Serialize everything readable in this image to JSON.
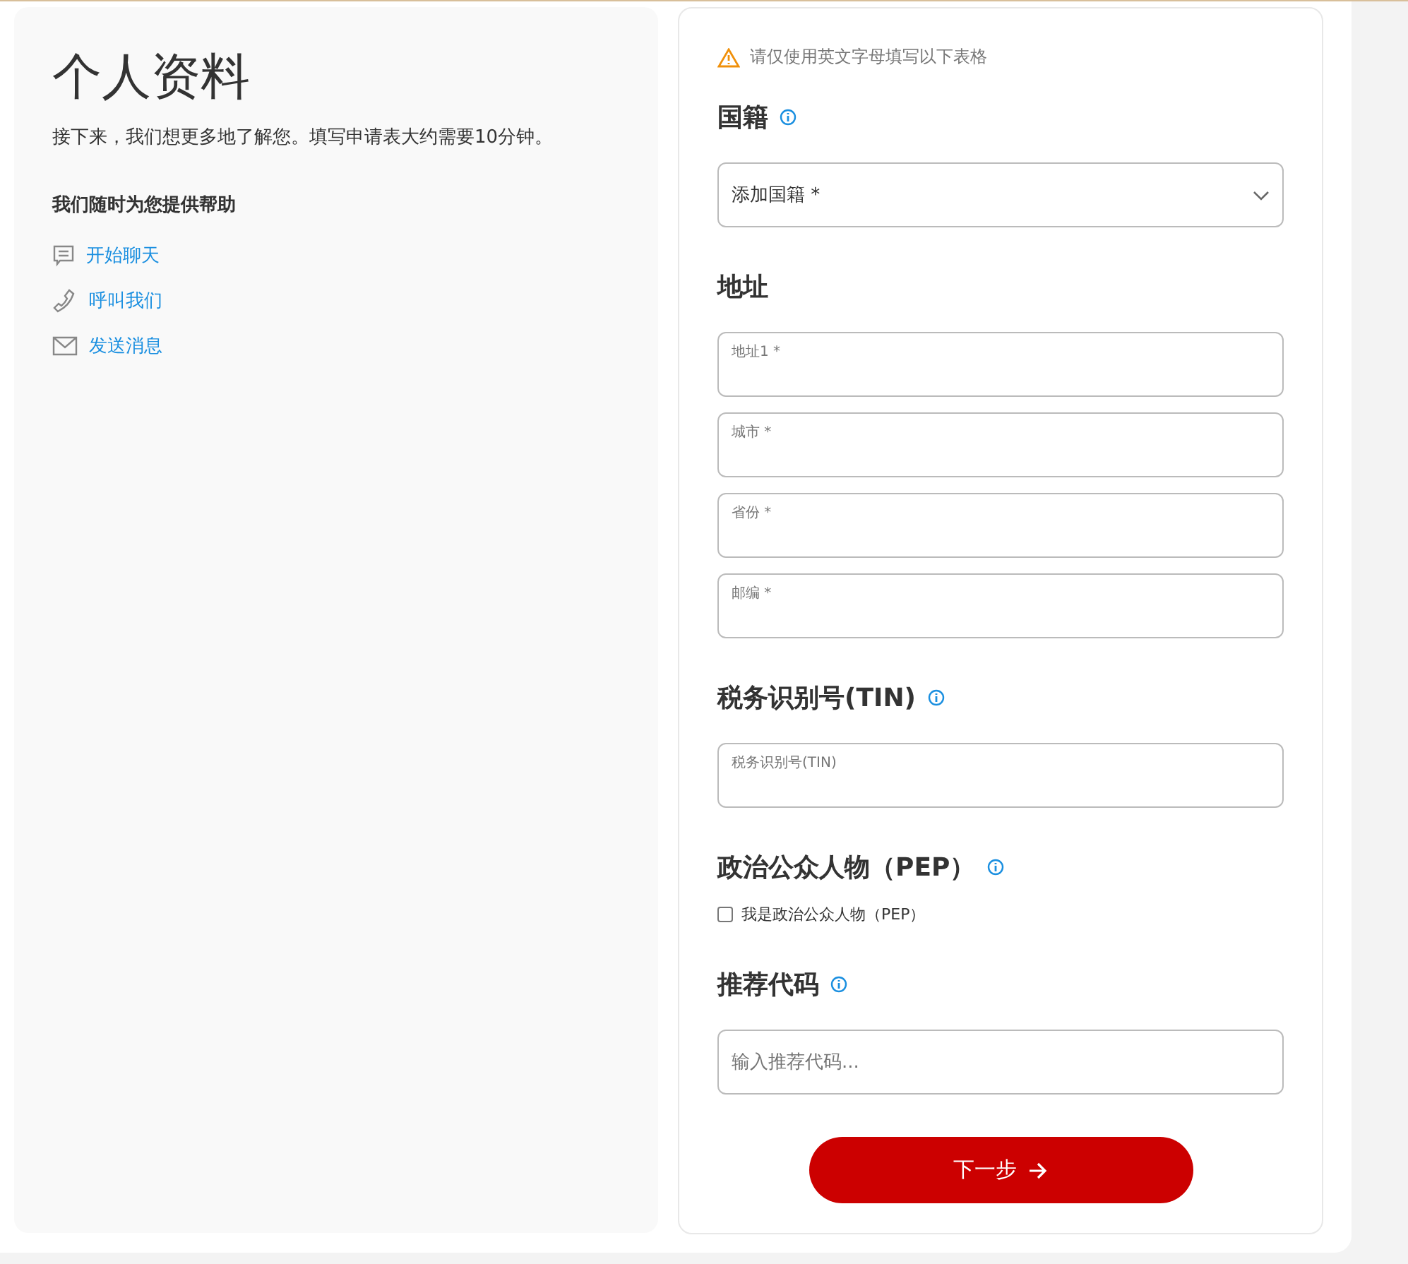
{
  "profile": {
    "title": "个人资料",
    "intro": "接下来，我们想更多地了解您。填写申请表大约需要10分钟。",
    "help_heading": "我们随时为您提供帮助",
    "help_links": [
      {
        "kind": "chat",
        "label": "开始聊天"
      },
      {
        "kind": "phone",
        "label": "呼叫我们"
      },
      {
        "kind": "mail",
        "label": "发送消息"
      }
    ]
  },
  "form": {
    "notice": "请仅使用英文字母填写以下表格",
    "sections": [
      {
        "heading": "国籍",
        "info": true,
        "fields": [
          {
            "kind": "select",
            "placeholder": "添加国籍 *"
          }
        ]
      },
      {
        "heading": "地址",
        "info": false,
        "fields": [
          {
            "kind": "floating",
            "label": "地址1 *"
          },
          {
            "kind": "floating",
            "label": "城市 *"
          },
          {
            "kind": "floating",
            "label": "省份 *"
          },
          {
            "kind": "floating",
            "label": "邮编 *"
          }
        ]
      },
      {
        "heading": "税务识别号(TIN)",
        "info": true,
        "fields": [
          {
            "kind": "floating",
            "label": "税务识别号(TIN)"
          }
        ]
      },
      {
        "heading": "政治公众人物（PEP）",
        "info": true,
        "fields": [
          {
            "kind": "checkbox",
            "label": "我是政治公众人物（PEP）",
            "checked": false
          }
        ]
      },
      {
        "heading": "推荐代码",
        "info": true,
        "fields": [
          {
            "kind": "text",
            "placeholder": "输入推荐代码..."
          }
        ]
      }
    ],
    "next_button": "下一步"
  }
}
